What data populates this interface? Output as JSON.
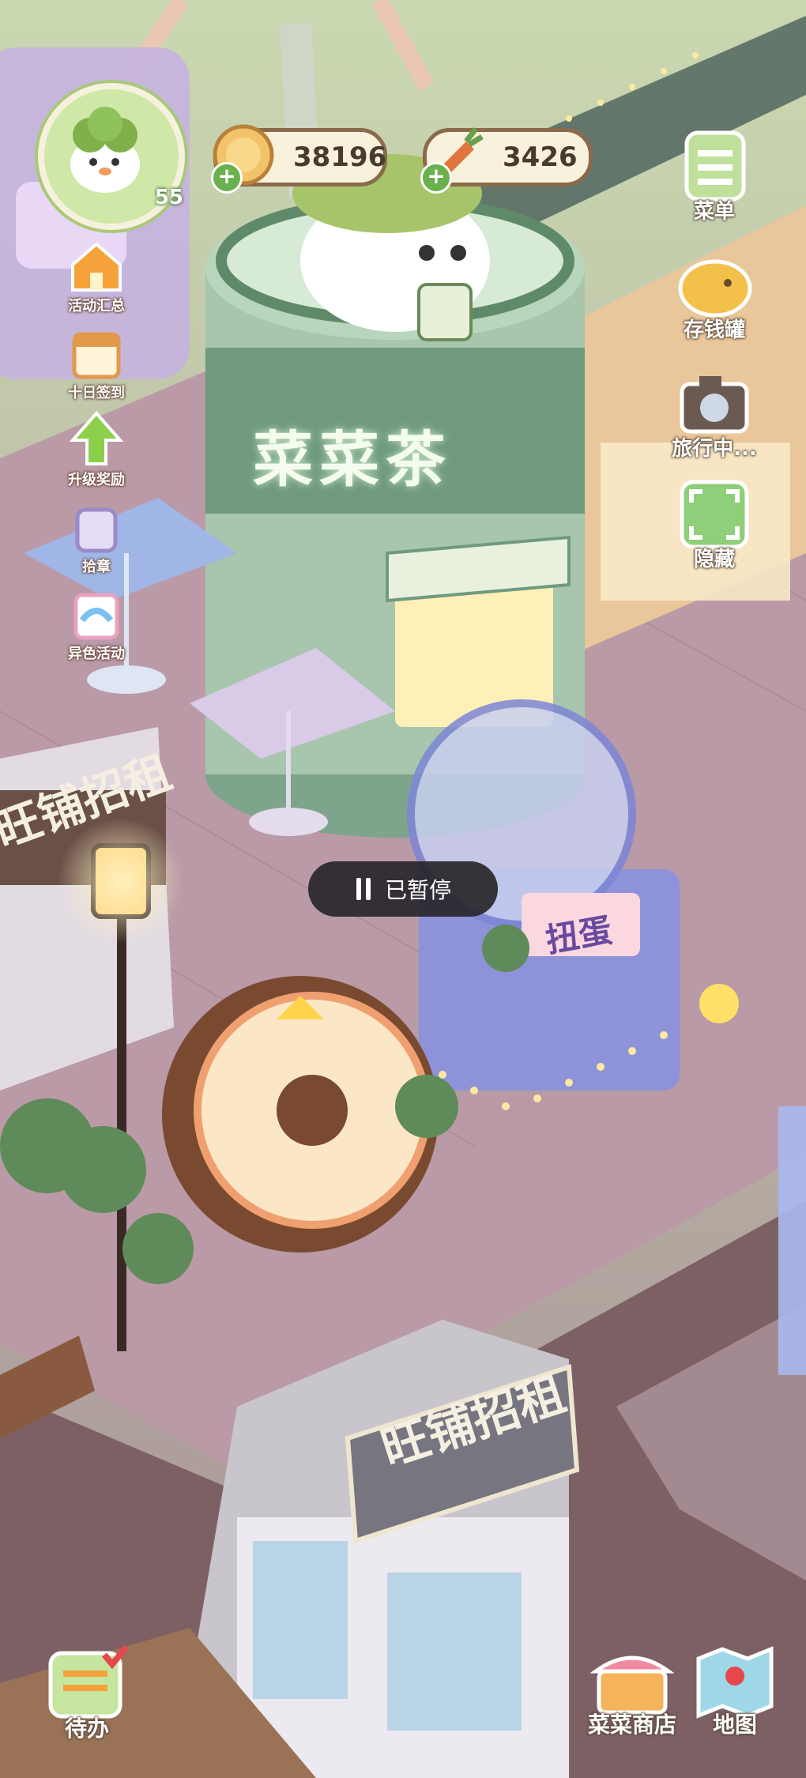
{
  "player": {
    "level": "55"
  },
  "currency": {
    "coins": "38196",
    "carrots": "3426"
  },
  "left_menu": [
    {
      "label": "活动汇总",
      "icon": "house-flag-icon"
    },
    {
      "label": "十日签到",
      "icon": "calendar-gift-icon"
    },
    {
      "label": "升级奖励",
      "icon": "level-up-arrow-icon"
    },
    {
      "label": "拾章",
      "icon": "badge-bag-icon"
    },
    {
      "label": "异色活动",
      "icon": "rainbow-card-icon"
    }
  ],
  "right_menu": [
    {
      "label": "菜单",
      "icon": "menu-list-icon"
    },
    {
      "label": "存钱罐",
      "icon": "piggy-bank-icon"
    },
    {
      "label": "旅行中...",
      "icon": "camera-icon"
    },
    {
      "label": "隐藏",
      "icon": "hide-frame-icon"
    }
  ],
  "bottom_menu": {
    "todo": "待办",
    "shop": "菜菜商店",
    "map": "地图"
  },
  "scene_text": {
    "tea_shop": "菜菜茶",
    "shop_rent_left": "旺铺招租",
    "shop_rent_bottom": "旺铺招租",
    "gacha": "扭蛋"
  },
  "status": {
    "paused": "已暂停"
  },
  "colors": {
    "ground": "#8a7476",
    "street": "#c4a5b0",
    "tea_cup": "#8fb79a",
    "accent_green": "#6ab04c"
  }
}
